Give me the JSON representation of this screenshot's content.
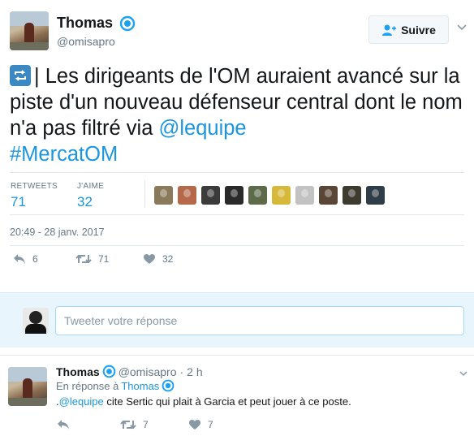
{
  "tweet": {
    "author_name": "Thomas",
    "author_handle": "@omisapro",
    "follow_label": "Suivre",
    "text_part1": "| Les dirigeants de l'OM auraient avancé sur la piste d'un nouveau défenseur central dont le nom n'a pas filtré via ",
    "mention": "@lequipe",
    "hashtag": "#MercatOM",
    "retweets_label": "RETWEETS",
    "retweets_count": "71",
    "likes_label": "J'AIME",
    "likes_count": "32",
    "timestamp": "20:49 - 28 janv. 2017",
    "actions": {
      "reply_count": "6",
      "retweet_count": "71",
      "like_count": "32"
    },
    "liker_avatars": [
      {
        "color": "#8a7a5c"
      },
      {
        "color": "#b5694a"
      },
      {
        "color": "#3b3b3b"
      },
      {
        "color": "#2a2a2a"
      },
      {
        "color": "#5d6b4a"
      },
      {
        "color": "#d6b83a"
      },
      {
        "color": "#c2c2c2"
      },
      {
        "color": "#5a4636"
      },
      {
        "color": "#3d3a30"
      },
      {
        "color": "#2e3d48"
      }
    ]
  },
  "reply_box": {
    "placeholder": "Tweeter votre réponse"
  },
  "reply": {
    "author_name": "Thomas",
    "author_handle": "@omisapro",
    "separator": "·",
    "time": "2 h",
    "in_reply_prefix": "En réponse à",
    "in_reply_name": "Thomas",
    "text_prefix": ".",
    "mention": "@lequipe",
    "text_rest": " cite Sertic qui plait à Garcia et peut jouer à ce poste.",
    "retweet_count": "7",
    "like_count": "7"
  },
  "colors": {
    "link": "#1b95e0",
    "secondary": "#657786",
    "reply_bg": "#e8f5fd"
  }
}
